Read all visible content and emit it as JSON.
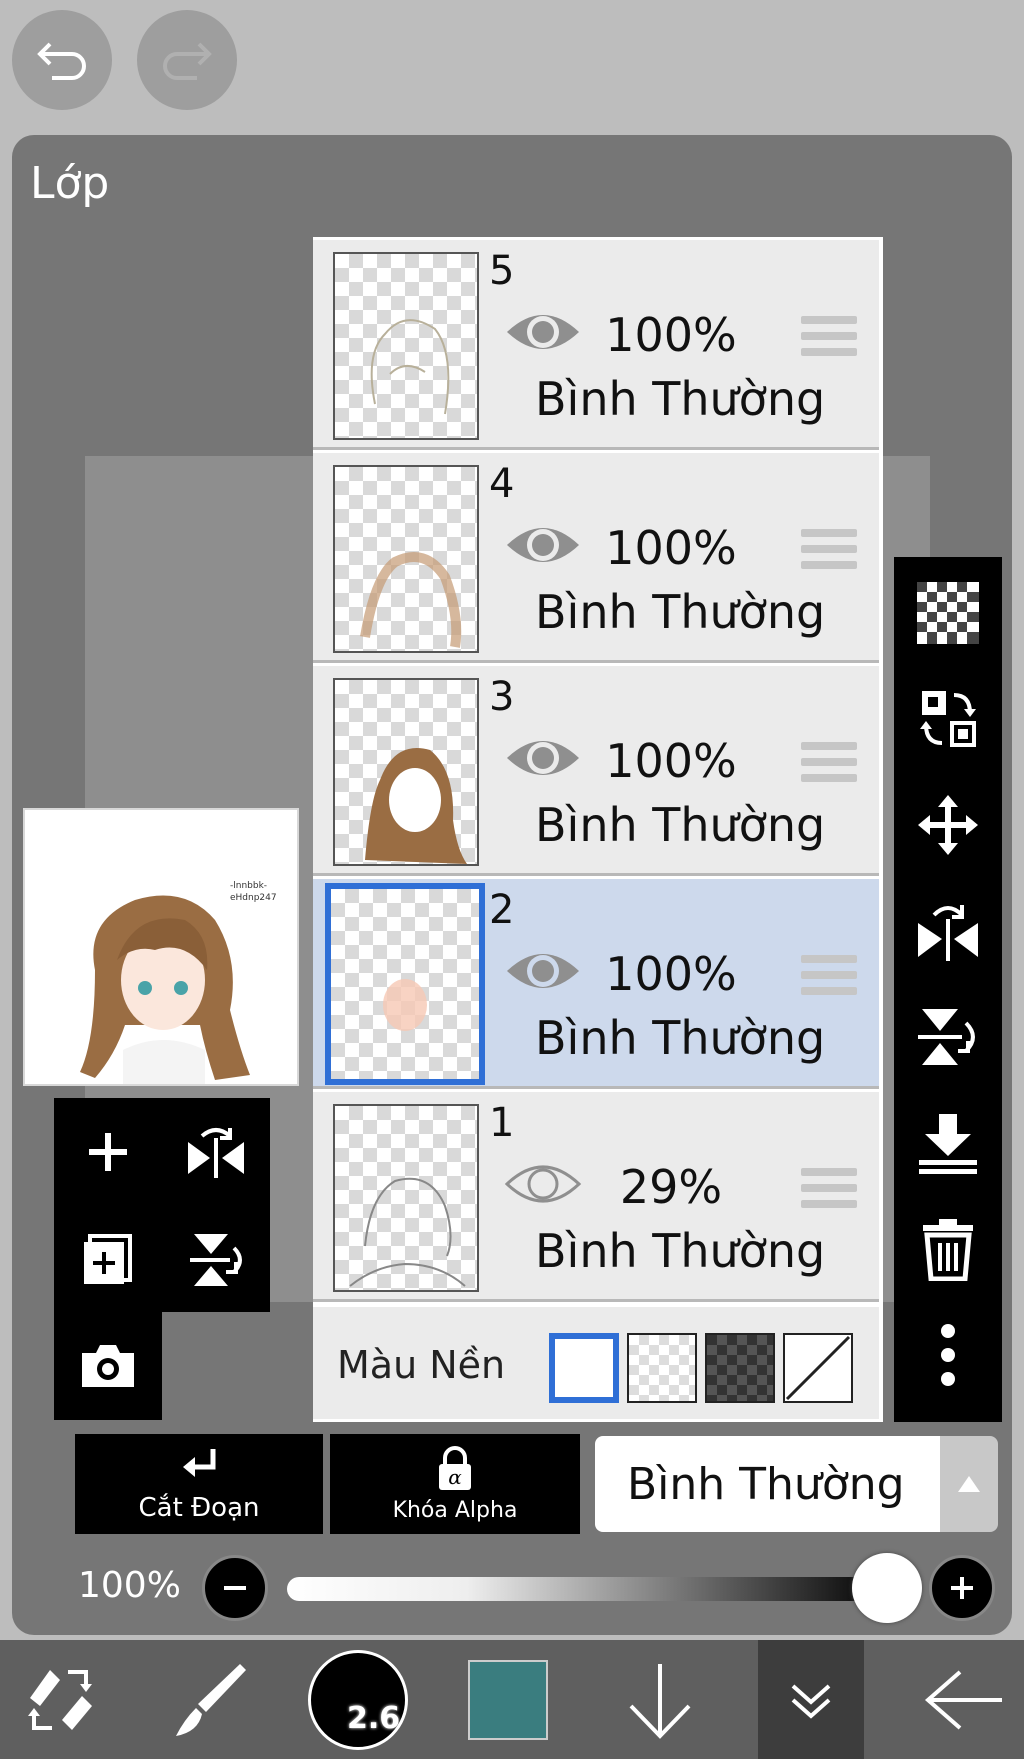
{
  "panel": {
    "title": "Lớp"
  },
  "layers": [
    {
      "number": "5",
      "opacity": "100%",
      "mode": "Bình Thường",
      "visible": true
    },
    {
      "number": "4",
      "opacity": "100%",
      "mode": "Bình Thường",
      "visible": true
    },
    {
      "number": "3",
      "opacity": "100%",
      "mode": "Bình Thường",
      "visible": true
    },
    {
      "number": "2",
      "opacity": "100%",
      "mode": "Bình Thường",
      "visible": true,
      "selected": true
    },
    {
      "number": "1",
      "opacity": "29%",
      "mode": "Bình Thường",
      "visible": false
    }
  ],
  "background": {
    "label": "Màu Nền",
    "options": [
      "white",
      "transparent",
      "dark-checker",
      "none"
    ],
    "selected": "white"
  },
  "actions": {
    "clipping_label": "Cắt Đoạn",
    "alpha_lock_label": "Khóa Alpha"
  },
  "blend_mode": {
    "selected": "Bình Thường"
  },
  "opacity_slider": {
    "label": "100%",
    "value": 1.0
  },
  "bottombar": {
    "brush_size": "2.6",
    "color": "#3a7d7f"
  },
  "preview": {
    "watermark_line1": "-lnnbbk-",
    "watermark_line2": "eHdnp247"
  },
  "icons": [
    "undo-icon",
    "redo-icon",
    "add-layer-icon",
    "duplicate-layer-icon",
    "camera-icon",
    "flip-h-icon",
    "flip-v-icon",
    "checker-icon",
    "swap-icon",
    "move-icon",
    "rotate-flip-icon",
    "merge-down-icon",
    "trash-icon",
    "more-icon"
  ]
}
